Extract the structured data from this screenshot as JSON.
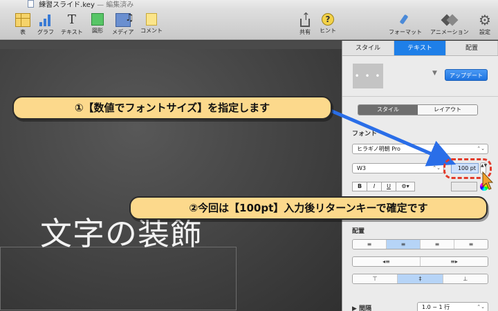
{
  "window": {
    "filename": "練習スライド.key",
    "separator": "—",
    "status": "編集済み"
  },
  "toolbar": {
    "items": [
      {
        "id": "table",
        "label": "表",
        "icon": "table-icon"
      },
      {
        "id": "chart",
        "label": "グラフ",
        "icon": "chart-icon"
      },
      {
        "id": "text",
        "label": "テキスト",
        "icon": "text-icon"
      },
      {
        "id": "shape",
        "label": "図形",
        "icon": "shape-icon"
      },
      {
        "id": "media",
        "label": "メディア",
        "icon": "media-icon"
      },
      {
        "id": "comment",
        "label": "コメント",
        "icon": "comment-icon"
      },
      {
        "id": "share",
        "label": "共有",
        "icon": "share-icon"
      },
      {
        "id": "hint",
        "label": "ヒント",
        "icon": "hint-icon"
      },
      {
        "id": "format",
        "label": "フォーマット",
        "icon": "format-brush-icon"
      },
      {
        "id": "animate",
        "label": "アニメーション",
        "icon": "animation-icon"
      },
      {
        "id": "settings",
        "label": "設定",
        "icon": "gear-icon"
      }
    ],
    "text_glyph": "T",
    "hint_glyph": "?",
    "gear_glyph": "⚙"
  },
  "slide": {
    "title": "文字の装飾"
  },
  "inspector": {
    "tabs": [
      {
        "label": "スタイル",
        "active": false
      },
      {
        "label": "テキスト",
        "active": true
      },
      {
        "label": "配置",
        "active": false
      }
    ],
    "preview_glyph": "• • •",
    "chevron": "▼",
    "update_label": "アップデート",
    "segment": [
      {
        "label": "スタイル",
        "active": true
      },
      {
        "label": "レイアウト",
        "active": false
      }
    ],
    "font_section_label": "フォント",
    "font_family": "ヒラギノ明朝 Pro",
    "font_weight": "W3",
    "font_size": "100 pt",
    "popup_arrows": "⌃⌄",
    "stepper_glyph": "▲▼",
    "format_buttons": [
      "B",
      "I",
      "U",
      "⚙▾"
    ],
    "alignment_label": "配置",
    "spacing_label": "▶ 間隔",
    "spacing_value": "1.0 − 1 行",
    "accent": "#1e7fe8"
  },
  "callouts": {
    "step1": "①【数値でフォントサイズ】を指定します",
    "step2": "②今回は【100pt】入力後リターンキーで確定です"
  },
  "colors": {
    "callout_fill": "#fcd98c",
    "highlight": "#e23b2b",
    "arrow": "#2a6ee8"
  }
}
